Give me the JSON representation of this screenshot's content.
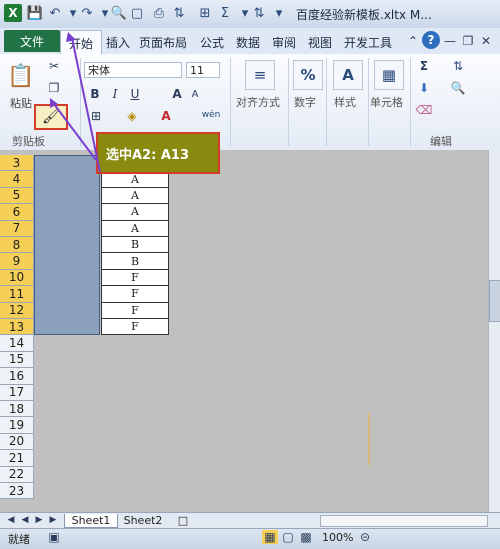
{
  "titlebar": {
    "app_icon": "X",
    "title": "百度经验新模板.xltx M..."
  },
  "tabs": [
    "文件",
    "开始",
    "插入",
    "页面布局",
    "公式",
    "数据",
    "审阅",
    "视图",
    "开发工具"
  ],
  "ribbon": {
    "clipboard": {
      "paste_label": "粘贴",
      "group_label": "剪贴板"
    },
    "font": {
      "font_name": "宋体",
      "font_size": "11",
      "bold": "B",
      "italic": "I",
      "underline": "U",
      "grow": "A",
      "shrink": "A",
      "wen": "wén"
    },
    "alignment": {
      "label": "对齐方式"
    },
    "number": {
      "label": "数字",
      "icon": "%"
    },
    "styles": {
      "label": "样式"
    },
    "cells": {
      "label": "单元格"
    },
    "editing": {
      "group_label": "编辑",
      "sigma": "Σ"
    }
  },
  "callout": {
    "text": "选中A2: A13"
  },
  "rows": [
    "3",
    "4",
    "5",
    "6",
    "7",
    "8",
    "9",
    "10",
    "11",
    "12",
    "13",
    "14",
    "15",
    "16",
    "17",
    "18",
    "19",
    "20",
    "21",
    "22",
    "23"
  ],
  "column_b_values": [
    "",
    "A",
    "A",
    "A",
    "A",
    "B",
    "B",
    "F",
    "F",
    "F",
    "F"
  ],
  "sheet_tabs": [
    "Sheet1",
    "Sheet2"
  ],
  "status": {
    "ready": "就绪",
    "zoom": "100%"
  }
}
